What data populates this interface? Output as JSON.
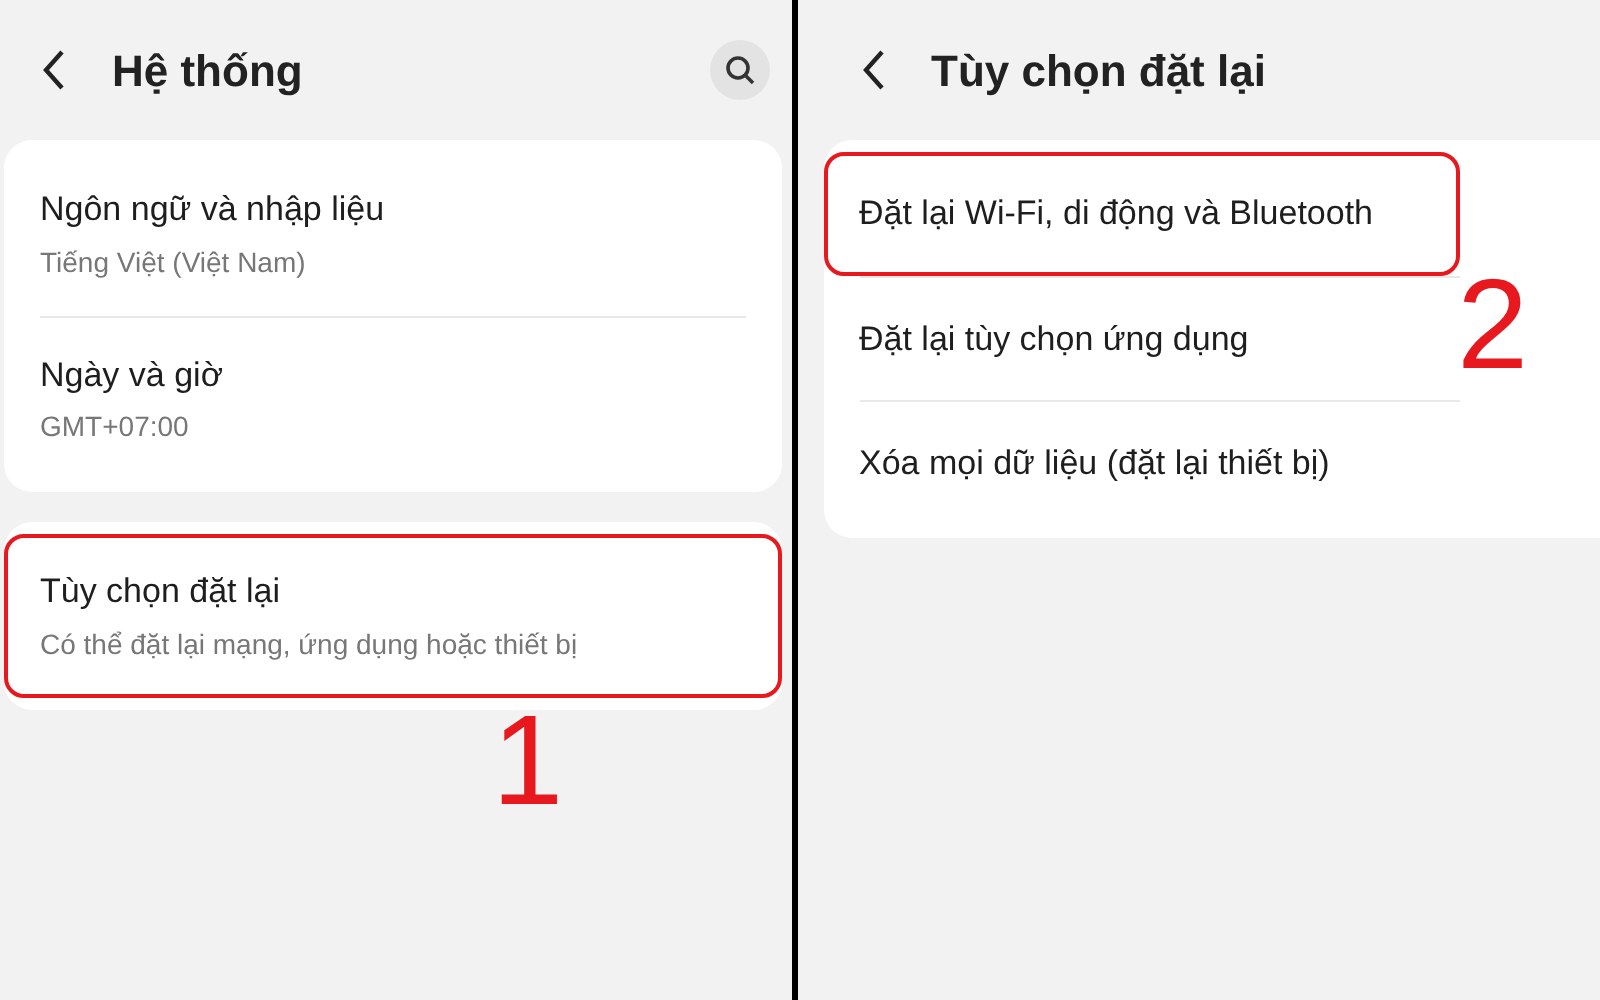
{
  "panels": [
    {
      "title": "Hệ thống",
      "search_button": true,
      "step": "1",
      "groups": [
        {
          "items": [
            {
              "title": "Ngôn ngữ và nhập liệu",
              "subtitle": "Tiếng Việt (Việt Nam)",
              "highlighted": false
            },
            {
              "title": "Ngày và giờ",
              "subtitle": "GMT+07:00",
              "highlighted": false
            }
          ]
        },
        {
          "items": [
            {
              "title": "Tùy chọn đặt lại",
              "subtitle": "Có thể đặt lại mạng, ứng dụng hoặc thiết bị",
              "highlighted": true
            }
          ]
        }
      ]
    },
    {
      "title": "Tùy chọn đặt lại",
      "search_button": false,
      "step": "2",
      "groups": [
        {
          "items": [
            {
              "title": "Đặt lại Wi-Fi, di động và Bluetooth",
              "highlighted": true
            },
            {
              "title": "Đặt lại tùy chọn ứng dụng",
              "highlighted": false
            },
            {
              "title": "Xóa mọi dữ liệu (đặt lại thiết bị)",
              "highlighted": false
            }
          ]
        }
      ]
    }
  ]
}
